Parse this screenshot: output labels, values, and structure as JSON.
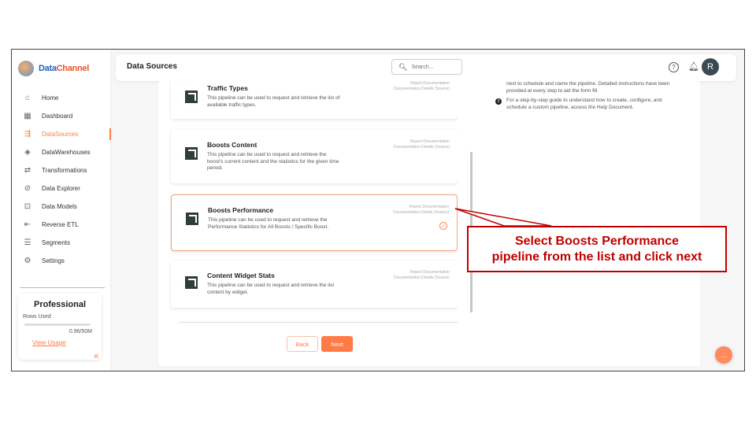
{
  "brand": {
    "name_part1": "Data",
    "name_part2": "Channel"
  },
  "sidebar": {
    "items": [
      {
        "label": "Home",
        "icon": "home-icon",
        "glyph": "⌂"
      },
      {
        "label": "Dashboard",
        "icon": "dashboard-icon",
        "glyph": "▦"
      },
      {
        "label": "DataSources",
        "icon": "datasources-icon",
        "glyph": "⇶",
        "active": true
      },
      {
        "label": "DataWarehouses",
        "icon": "warehouse-icon",
        "glyph": "◈"
      },
      {
        "label": "Transformations",
        "icon": "transform-icon",
        "glyph": "⇄"
      },
      {
        "label": "Data Explorer",
        "icon": "explorer-icon",
        "glyph": "⊘"
      },
      {
        "label": "Data Models",
        "icon": "models-icon",
        "glyph": "⊡"
      },
      {
        "label": "Reverse ETL",
        "icon": "reverse-etl-icon",
        "glyph": "⇤"
      },
      {
        "label": "Segments",
        "icon": "segments-icon",
        "glyph": "☰"
      },
      {
        "label": "Settings",
        "icon": "settings-icon",
        "glyph": "⚙"
      }
    ],
    "plan": {
      "title": "Professional",
      "rows_label": "Rows Used",
      "rows_value": "0.96/50M",
      "link": "View Usage"
    },
    "collapse_glyph": "«"
  },
  "header": {
    "title": "Data Sources",
    "search_placeholder": "Search...",
    "avatar_letter": "R",
    "help_glyph": "?",
    "bell_glyph": "🔔"
  },
  "pipelines": [
    {
      "name": "Traffic Types",
      "desc": "This pipeline can be used to request and retrieve the list of available traffic types.",
      "doc1": "Report Documentation",
      "doc2": "Documentation Details (Source)"
    },
    {
      "name": "Boosts Content",
      "desc": "This pipeline can be used to request and retrieve the boost's current content and the statistics for the given time period.",
      "doc1": "Report Documentation",
      "doc2": "Documentation Details (Source)"
    },
    {
      "name": "Boosts Performance",
      "desc": "This pipeline can be used to request and retrieve the Performance Statistics for All Boosts / Specific Boost.",
      "doc1": "Report Documentation",
      "doc2": "Documentation Details (Source)",
      "selected": true
    },
    {
      "name": "Content Widget Stats",
      "desc": "This pipeline can be used to request and retrieve the list content by widget.",
      "doc1": "Report Documentation",
      "doc2": "Documentation Details (Source)"
    }
  ],
  "buttons": {
    "back": "Back",
    "next": "Next"
  },
  "instructions": {
    "step2_tail": "next to schedule and name the pipeline. Detailed instructions have been provided at every step to aid the form fill",
    "step3_num": "3",
    "step3": "For a step-by-step guide to understand how to create, configure, and schedule a custom pipeline, access the Help Document."
  },
  "callout": {
    "line1": "Select Boosts Performance",
    "line2": "pipeline from the list and click next"
  },
  "colors": {
    "accent": "#ff7a45",
    "callout": "#c00000",
    "brand_blue": "#1e5fb4"
  }
}
